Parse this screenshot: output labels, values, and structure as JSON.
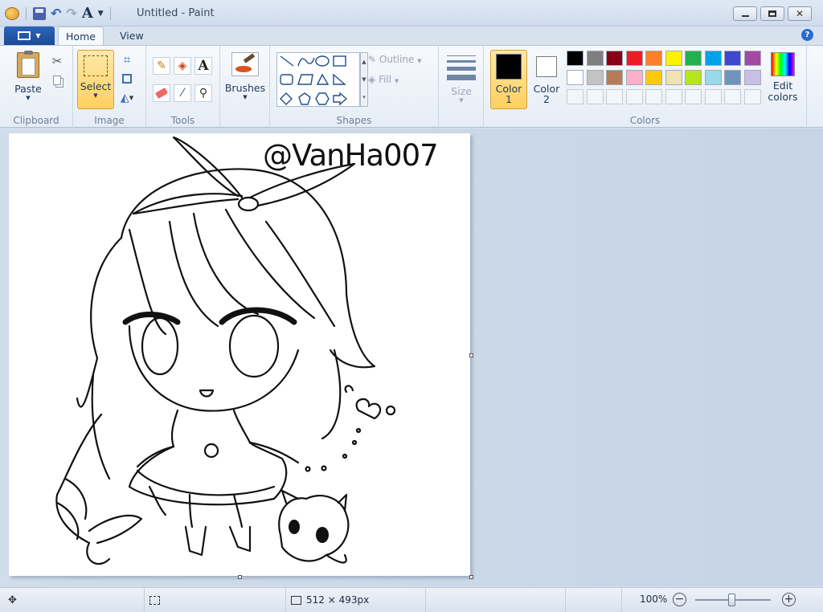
{
  "window": {
    "title": "Untitled - Paint"
  },
  "tabs": [
    {
      "label": "Home"
    },
    {
      "label": "View"
    }
  ],
  "clipboard": {
    "paste_label": "Paste",
    "group_label": "Clipboard"
  },
  "image": {
    "select_label": "Select",
    "group_label": "Image"
  },
  "tools": {
    "group_label": "Tools"
  },
  "brushes": {
    "label": "Brushes"
  },
  "shapes": {
    "outline_label": "Outline",
    "fill_label": "Fill",
    "group_label": "Shapes"
  },
  "size": {
    "label": "Size"
  },
  "colors": {
    "color1_label": "Color",
    "color1_num": "1",
    "color2_label": "Color",
    "color2_num": "2",
    "edit_label_1": "Edit",
    "edit_label_2": "colors",
    "group_label": "Colors",
    "color1": "#000000",
    "color2": "#ffffff",
    "palette_row1": [
      "#000000",
      "#7f7f7f",
      "#880015",
      "#ed1c24",
      "#ff7f27",
      "#fff200",
      "#22b14c",
      "#00a2e8",
      "#3f48cc",
      "#a349a4"
    ],
    "palette_row2": [
      "#ffffff",
      "#c3c3c3",
      "#b97a57",
      "#ffaec9",
      "#ffc90e",
      "#efe4b0",
      "#b5e61d",
      "#99d9ea",
      "#7092be",
      "#c8bfe7"
    ]
  },
  "canvas": {
    "watermark": "@VanHa007"
  },
  "status": {
    "dimensions": "512 × 493px",
    "zoom": "100%"
  }
}
